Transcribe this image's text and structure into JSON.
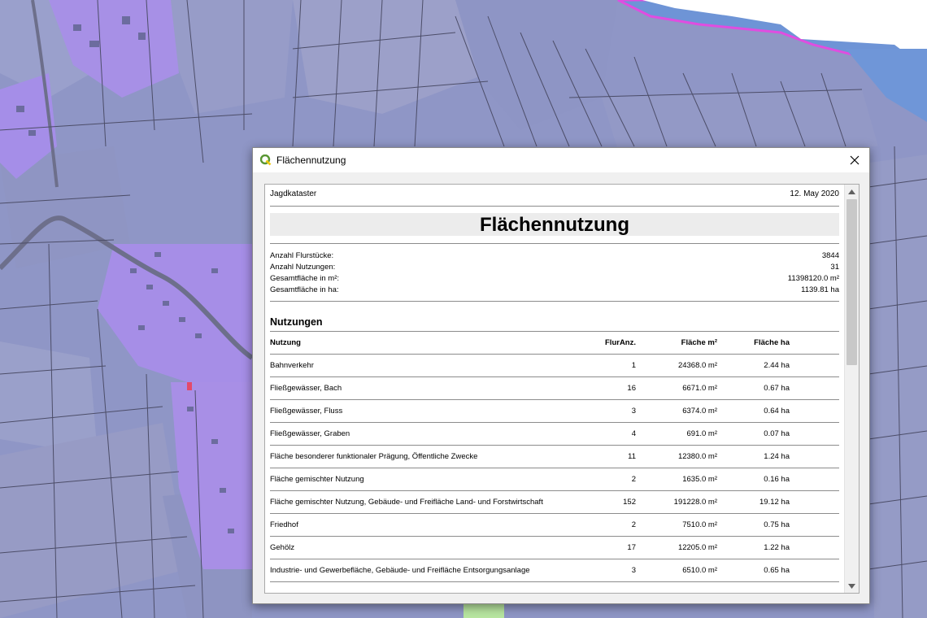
{
  "window": {
    "title": "Flächennutzung",
    "icon": "qgis-logo-icon",
    "close_icon": "close-icon"
  },
  "report": {
    "header_left": "Jagdkataster",
    "header_right": "12. May 2020",
    "title": "Flächennutzung",
    "stats": [
      {
        "label": "Anzahl Flurstücke:",
        "value": "3844"
      },
      {
        "label": "Anzahl Nutzungen:",
        "value": "31"
      },
      {
        "label": "Gesamtfläche in m²:",
        "value": "11398120.0 m²"
      },
      {
        "label": "Gesamtfläche in ha:",
        "value": "1139.81 ha"
      }
    ],
    "section_title": "Nutzungen",
    "columns": [
      "Nutzung",
      "FlurAnz.",
      "Fläche m²",
      "Fläche ha"
    ],
    "rows": [
      [
        "Bahnverkehr",
        "1",
        "24368.0 m²",
        "2.44 ha"
      ],
      [
        "Fließgewässer, Bach",
        "16",
        "6671.0 m²",
        "0.67 ha"
      ],
      [
        "Fließgewässer, Fluss",
        "3",
        "6374.0 m²",
        "0.64 ha"
      ],
      [
        "Fließgewässer, Graben",
        "4",
        "691.0 m²",
        "0.07 ha"
      ],
      [
        "Fläche besonderer funktionaler Prägung, Öffentliche Zwecke",
        "11",
        "12380.0 m²",
        "1.24 ha"
      ],
      [
        "Fläche gemischter Nutzung",
        "2",
        "1635.0 m²",
        "0.16 ha"
      ],
      [
        "Fläche gemischter Nutzung, Gebäude- und Freifläche Land- und Forstwirtschaft",
        "152",
        "191228.0 m²",
        "19.12 ha"
      ],
      [
        "Friedhof",
        "2",
        "7510.0 m²",
        "0.75 ha"
      ],
      [
        "Gehölz",
        "17",
        "12205.0 m²",
        "1.22 ha"
      ],
      [
        "Industrie- und Gewerbefläche, Gebäude- und Freifläche Entsorgungsanlage",
        "3",
        "6510.0 m²",
        "0.65 ha"
      ]
    ]
  },
  "colors": {
    "map_base": "#8f96c6",
    "map_builtup": "#a78ee6",
    "map_water": "#6d93d8",
    "map_outline": "#4c4d68",
    "lake_border": "#e04de0"
  }
}
